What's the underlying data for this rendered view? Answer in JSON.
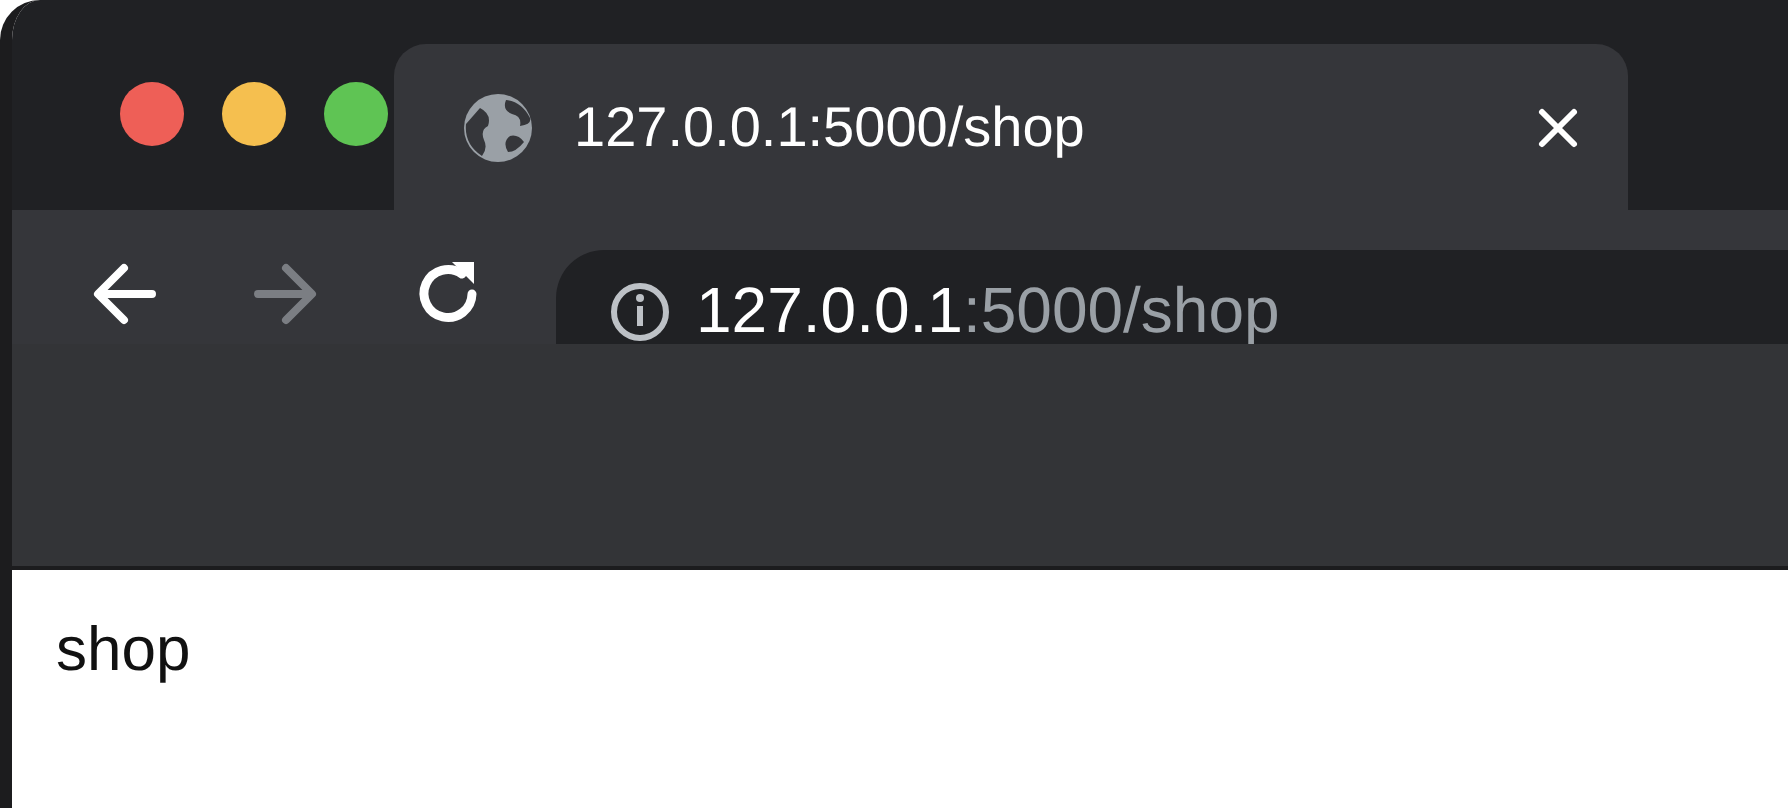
{
  "tab": {
    "title": "127.0.0.1:5000/shop",
    "selected": true
  },
  "toolbar": {
    "forward_disabled": true
  },
  "address_bar": {
    "host": "127.0.0.1",
    "rest": ":5000/shop"
  },
  "page": {
    "text": "shop"
  }
}
